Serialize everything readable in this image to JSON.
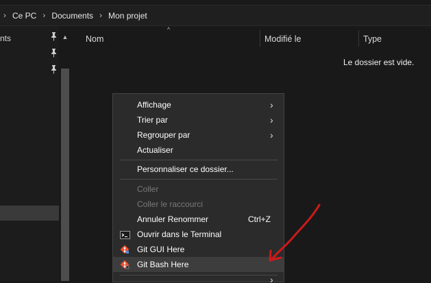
{
  "breadcrumb": {
    "items": [
      "Ce PC",
      "Documents",
      "Mon projet"
    ]
  },
  "nav": {
    "rows": [
      {
        "label": "nts",
        "pinned": true
      },
      {
        "label": "",
        "pinned": true
      },
      {
        "label": "",
        "pinned": true
      }
    ]
  },
  "columns": {
    "name": "Nom",
    "modified": "Modifié le",
    "type": "Type"
  },
  "empty_message": "Le dossier est vide.",
  "context_menu": {
    "group1": [
      {
        "label": "Affichage",
        "submenu": true
      },
      {
        "label": "Trier par",
        "submenu": true
      },
      {
        "label": "Regrouper par",
        "submenu": true
      },
      {
        "label": "Actualiser",
        "submenu": false
      }
    ],
    "customize": "Personnaliser ce dossier...",
    "paste": "Coller",
    "paste_shortcut": "Coller le raccourci",
    "undo": "Annuler Renommer",
    "undo_shortcut": "Ctrl+Z",
    "terminal": "Ouvrir dans le Terminal",
    "git_gui": "Git GUI Here",
    "git_bash": "Git Bash Here"
  },
  "colors": {
    "annotation_arrow": "#cc1a1a",
    "git_orange": "#f05032"
  }
}
